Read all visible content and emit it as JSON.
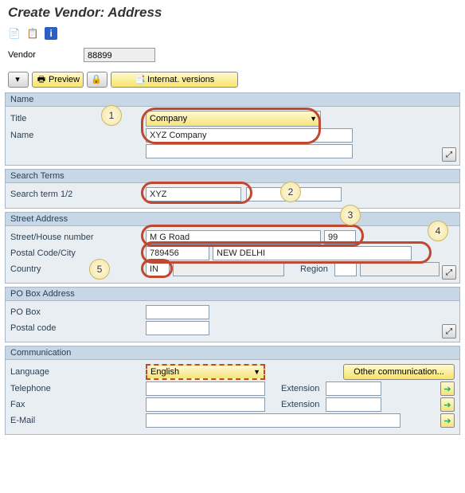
{
  "page_title": "Create Vendor: Address",
  "vendor_label": "Vendor",
  "vendor_value": "88899",
  "cmdbar": {
    "preview_label": "Preview",
    "internat_label": "Internat. versions"
  },
  "name": {
    "header": "Name",
    "title_label": "Title",
    "title_value": "Company",
    "name_label": "Name",
    "name_value": "XYZ Company"
  },
  "search": {
    "header": "Search Terms",
    "term_label": "Search term 1/2",
    "term_value": "XYZ"
  },
  "street": {
    "header": "Street Address",
    "street_label": "Street/House number",
    "street_value": "M G Road",
    "house_value": "99",
    "postal_label": "Postal Code/City",
    "postal_value": "789456",
    "city_value": "NEW DELHI",
    "country_label": "Country",
    "country_value": "IN",
    "region_label": "Region",
    "region_value": ""
  },
  "pobox": {
    "header": "PO Box Address",
    "po_label": "PO Box",
    "postal_label": "Postal code"
  },
  "comm": {
    "header": "Communication",
    "lang_label": "Language",
    "lang_value": "English",
    "other_label": "Other communication...",
    "tel_label": "Telephone",
    "ext_label": "Extension",
    "fax_label": "Fax",
    "email_label": "E-Mail"
  },
  "annotations": {
    "b1": "1",
    "b2": "2",
    "b3": "3",
    "b4": "4",
    "b5": "5"
  }
}
